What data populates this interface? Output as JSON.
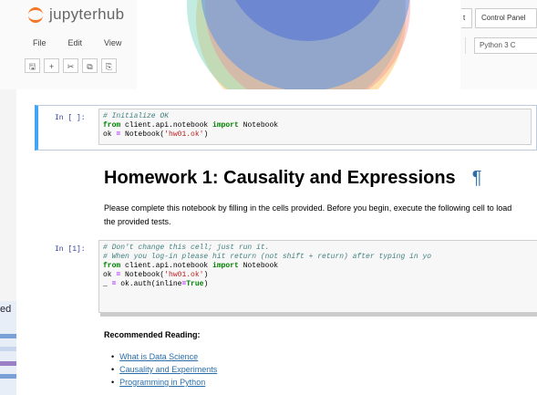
{
  "app": {
    "logo_name": "jupyterhub",
    "logo_icon": "jupyter-logo-icon",
    "brand_color": "#f37726"
  },
  "header": {
    "buttons": {
      "partial_left": "t",
      "control_panel": "Control Panel"
    }
  },
  "menu": {
    "items": [
      "File",
      "Edit",
      "View"
    ]
  },
  "toolbar": {
    "icons": [
      "save-icon",
      "add-cell-icon",
      "cut-icon",
      "copy-icon",
      "paste-icon"
    ],
    "glyphs": [
      "🖫",
      "+",
      "✂",
      "⧉",
      "⎘"
    ]
  },
  "kernel": {
    "label": "Python 3 C"
  },
  "cells": [
    {
      "prompt": "In [ ]:",
      "lines": [
        [
          {
            "t": "# Initialize OK",
            "c": "c-comment"
          }
        ],
        [
          {
            "t": "from",
            "c": "c-kw"
          },
          {
            "t": " client.api.notebook ",
            "c": ""
          },
          {
            "t": "import",
            "c": "c-kw"
          },
          {
            "t": " Notebook",
            "c": ""
          }
        ],
        [
          {
            "t": "ok ",
            "c": ""
          },
          {
            "t": "=",
            "c": "c-op"
          },
          {
            "t": " Notebook(",
            "c": ""
          },
          {
            "t": "'hw01.ok'",
            "c": "c-str"
          },
          {
            "t": ")",
            "c": ""
          }
        ]
      ]
    },
    {
      "prompt": "In [1]:",
      "lines": [
        [
          {
            "t": "# Don't change this cell; just run it.",
            "c": "c-comment"
          }
        ],
        [
          {
            "t": "# When you log-in please hit return (not shift + return) after typing in yo",
            "c": "c-comment"
          }
        ],
        [
          {
            "t": "from",
            "c": "c-kw"
          },
          {
            "t": " client.api.notebook ",
            "c": ""
          },
          {
            "t": "import",
            "c": "c-kw"
          },
          {
            "t": " Notebook",
            "c": ""
          }
        ],
        [
          {
            "t": "ok ",
            "c": ""
          },
          {
            "t": "=",
            "c": "c-op"
          },
          {
            "t": " Notebook(",
            "c": ""
          },
          {
            "t": "'hw01.ok'",
            "c": "c-str"
          },
          {
            "t": ")",
            "c": ""
          }
        ],
        [
          {
            "t": "_ ",
            "c": ""
          },
          {
            "t": "=",
            "c": "c-op"
          },
          {
            "t": " ok.auth(inline",
            "c": ""
          },
          {
            "t": "=",
            "c": "c-op"
          },
          {
            "t": "True",
            "c": "c-kw"
          },
          {
            "t": ")",
            "c": ""
          }
        ]
      ]
    }
  ],
  "markdown": {
    "title": "Homework 1: Causality and Expressions",
    "pilcrow": "¶",
    "paragraph": "Please complete this notebook by filling in the cells provided. Before you begin, execute the following cell to load the provided tests.",
    "recommended_heading": "Recommended Reading:",
    "links": [
      "What is Data Science",
      "Causality and Experiments",
      "Programming in Python"
    ]
  },
  "background_window": {
    "partial_text": "ed"
  }
}
